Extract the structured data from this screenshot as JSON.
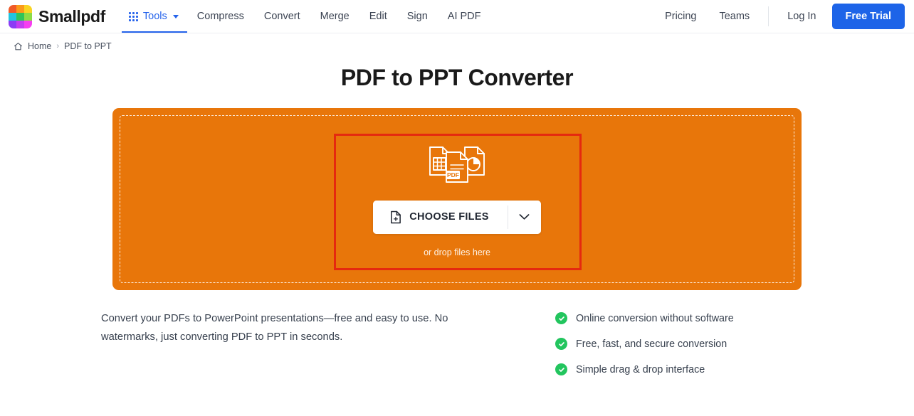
{
  "header": {
    "brand_name": "Smallpdf",
    "logo_colors": [
      "#f05a28",
      "#fb9a1a",
      "#f9d422",
      "#20c4e0",
      "#2fc45a",
      "#8ddc45",
      "#8b3df5",
      "#c43df0",
      "#f63df0"
    ],
    "tools": {
      "label": "Tools",
      "icon": "apps-grid-icon",
      "caret": "chevron-down-icon"
    },
    "nav_items": [
      {
        "label": "Compress"
      },
      {
        "label": "Convert"
      },
      {
        "label": "Merge"
      },
      {
        "label": "Edit"
      },
      {
        "label": "Sign"
      },
      {
        "label": "AI PDF"
      }
    ],
    "right_items": [
      {
        "label": "Pricing"
      },
      {
        "label": "Teams"
      }
    ],
    "login_label": "Log In",
    "trial_label": "Free Trial",
    "accent_blue": "#1d64e8"
  },
  "breadcrumb": {
    "home_icon": "home-icon",
    "home_label": "Home",
    "separator": "›",
    "current_label": "PDF to PPT"
  },
  "main": {
    "title": "PDF to PPT Converter",
    "dropzone": {
      "icon": "pdf-to-ppt-documents-icon",
      "choose_files_label": "CHOOSE FILES",
      "choose_files_icon": "file-plus-icon",
      "dropdown_icon": "chevron-down-icon",
      "drop_hint": "or drop files here",
      "background_color": "#e8760a"
    },
    "annotation": {
      "color": "#e5290f",
      "shape": "rectangle"
    },
    "description": "Convert your PDFs to PowerPoint presentations—free and easy to use. No watermarks, just converting PDF to PPT in seconds.",
    "features": [
      {
        "icon": "check-circle-icon",
        "label": "Online conversion without software"
      },
      {
        "icon": "check-circle-icon",
        "label": "Free, fast, and secure conversion"
      },
      {
        "icon": "check-circle-icon",
        "label": "Simple drag & drop interface"
      }
    ],
    "feature_icon_color": "#22c55e"
  }
}
